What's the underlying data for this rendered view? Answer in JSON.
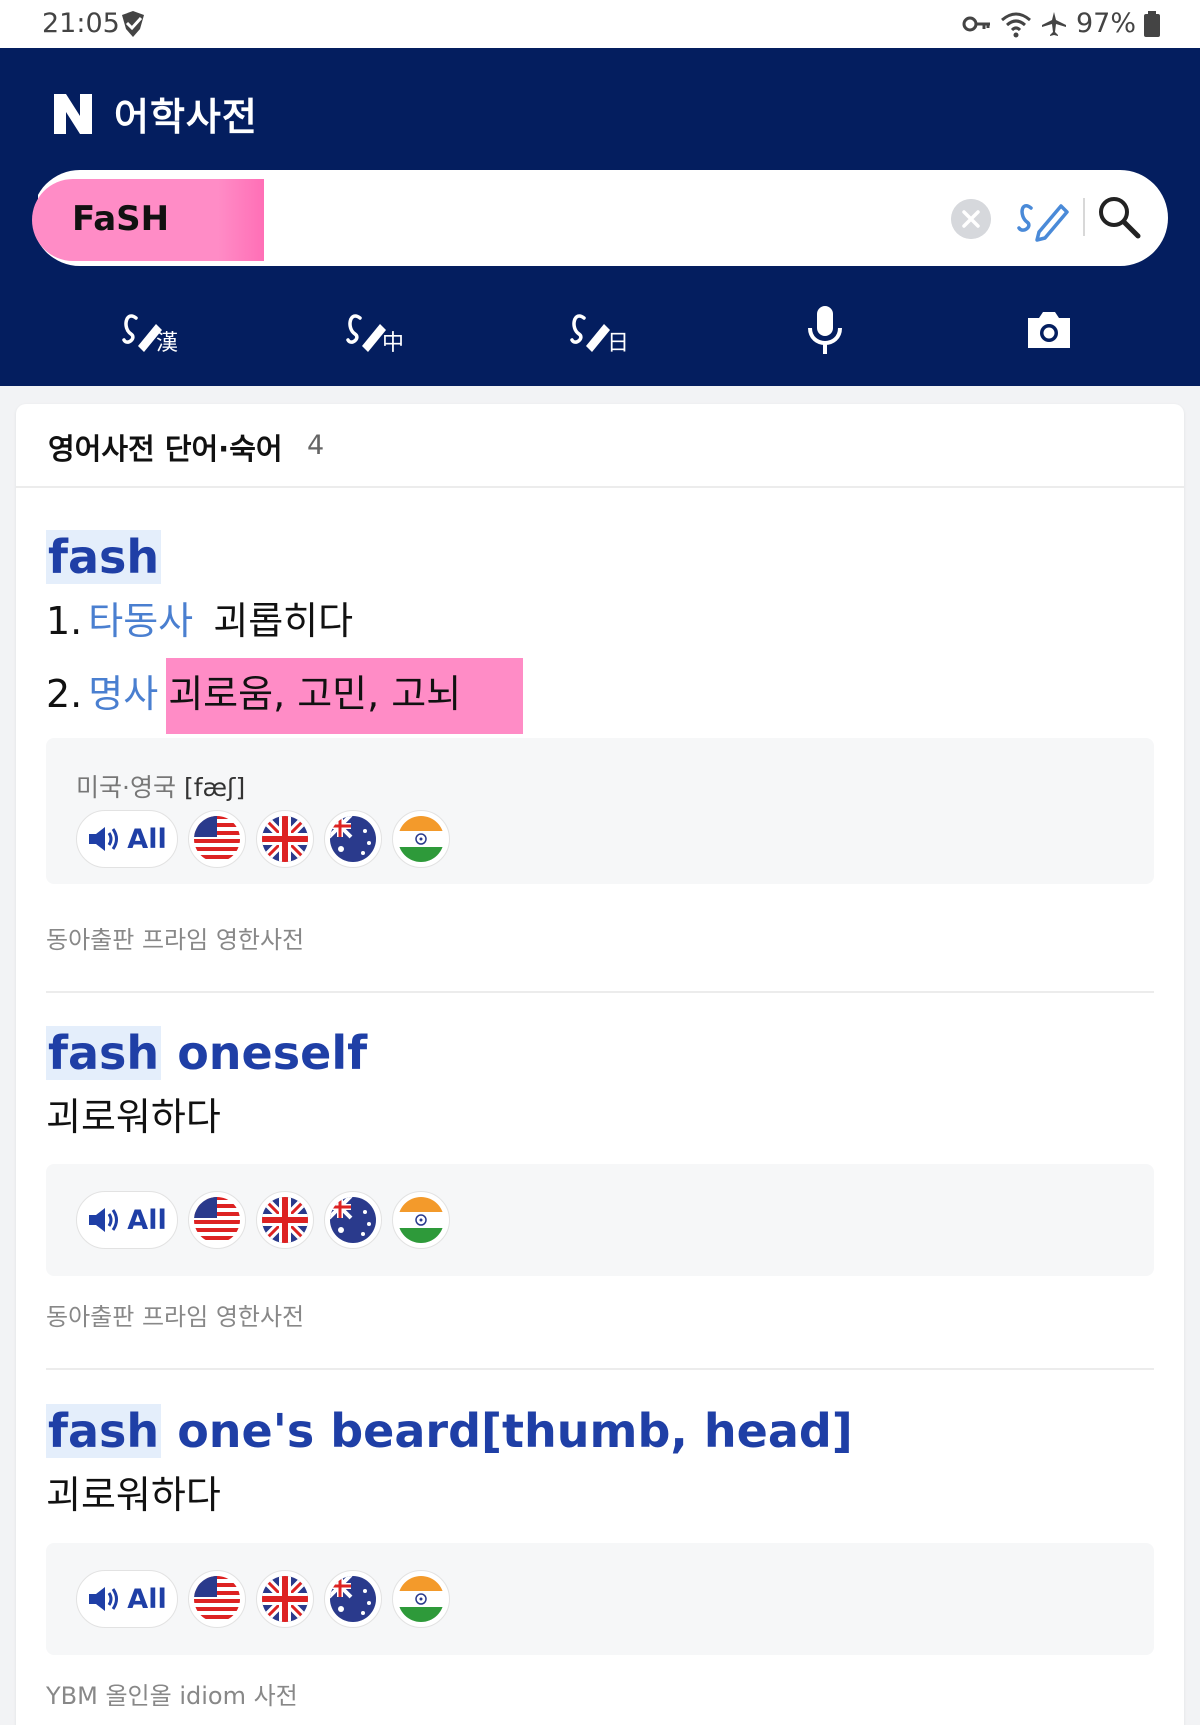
{
  "status_bar": {
    "time": "21:05",
    "battery": "97%"
  },
  "header": {
    "logo_text": "N",
    "title": "어학사전",
    "search": {
      "query": "FaSH"
    },
    "tools": [
      "hanja-handwriting-icon",
      "chinese-handwriting-icon",
      "japanese-handwriting-icon",
      "microphone-icon",
      "camera-icon"
    ]
  },
  "results": {
    "section_title": "영어사전 단어·숙어",
    "count": "4",
    "entries": [
      {
        "headword_hl": "fash",
        "headword_rest": "",
        "senses": [
          {
            "num": "1.",
            "pos": "타동사",
            "meaning": "괴롭히다"
          },
          {
            "num": "2.",
            "pos": "명사",
            "meaning": "괴로움, 고민, 고뇌"
          }
        ],
        "pron_region": "미국·영국",
        "pron_ipa": "[fæʃ]",
        "audio_all": "All",
        "source": "동아출판 프라임 영한사전"
      },
      {
        "headword_hl": "fash",
        "headword_rest": " oneself",
        "meaning": "괴로워하다",
        "audio_all": "All",
        "source": "동아출판 프라임 영한사전"
      },
      {
        "headword_hl": "fash",
        "headword_rest": " one's beard[thumb, head]",
        "meaning": "괴로워하다",
        "audio_all": "All",
        "source": "YBM 올인올 idiom 사전"
      }
    ]
  },
  "colors": {
    "header_bg": "#041e5f",
    "headword": "#1f3fa6",
    "pos": "#4a7fd0",
    "highlight": "#ff8cc6"
  }
}
